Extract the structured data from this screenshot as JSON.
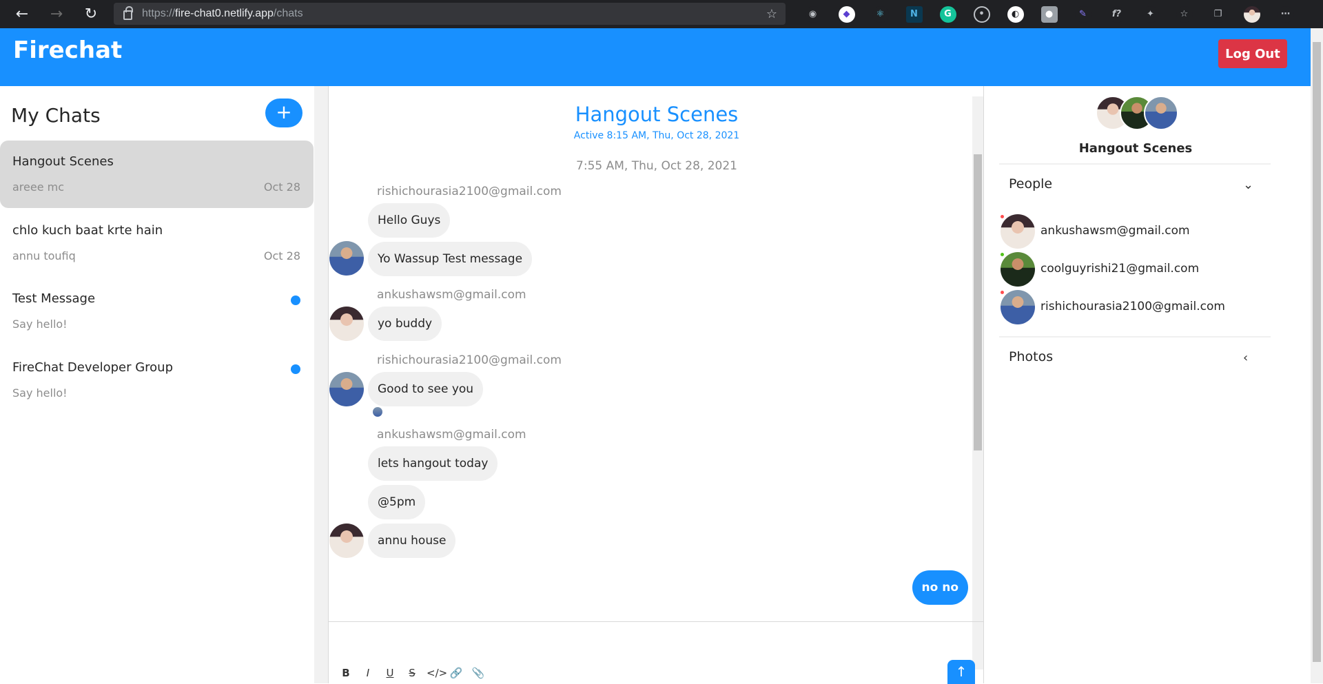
{
  "browser": {
    "url_scheme": "https://",
    "url_domain": "fire-chat0.netlify.app",
    "url_path": "/chats"
  },
  "header": {
    "app_title": "Firechat",
    "logout_label": "Log Out"
  },
  "chat_list": {
    "title": "My Chats",
    "new_chat_label": "+",
    "chats": [
      {
        "name": "Hangout Scenes",
        "last_message": "areee mc",
        "date": "Oct 28",
        "active": true
      },
      {
        "name": "chlo kuch baat krte hain",
        "last_message": "annu toufiq",
        "date": "Oct 28"
      },
      {
        "name": "Test Message",
        "last_message": "Say hello!",
        "date": ""
      },
      {
        "name": "FireChat Developer Group",
        "last_message": "Say hello!",
        "date": ""
      }
    ]
  },
  "feed": {
    "title": "Hangout Scenes",
    "subtitle": "Active 8:15 AM, Thu, Oct 28, 2021",
    "timestamp": "7:55 AM, Thu, Oct 28, 2021",
    "senders": [
      "rishichourasia2100@gmail.com",
      "ankushawsm@gmail.com",
      "rishichourasia2100@gmail.com",
      "ankushawsm@gmail.com"
    ],
    "messages": [
      "Hello Guys",
      "Yo Wassup Test message",
      "yo buddy",
      "Good to see you",
      "lets hangout today",
      "@5pm",
      "annu house",
      "no no"
    ],
    "send_label": "↑"
  },
  "settings": {
    "group_name": "Hangout Scenes",
    "people_title": "People",
    "photos_title": "Photos",
    "people": [
      "ankushawsm@gmail.com",
      "coolguyrishi21@gmail.com",
      "rishichourasia2100@gmail.com"
    ],
    "status_colors": [
      "#ff4d4f",
      "#52c41a",
      "#ff4d4f"
    ]
  },
  "icons": {
    "back": "back-arrow-icon",
    "forward": "forward-arrow-icon",
    "refresh": "refresh-icon",
    "chevron_down": "chevron-down-icon",
    "chevron_left": "chevron-left-icon"
  },
  "colors": {
    "brand": "#1890ff",
    "danger": "#dc3545",
    "bubble": "#f0f0f0",
    "active_chat": "#d9d9d9"
  }
}
